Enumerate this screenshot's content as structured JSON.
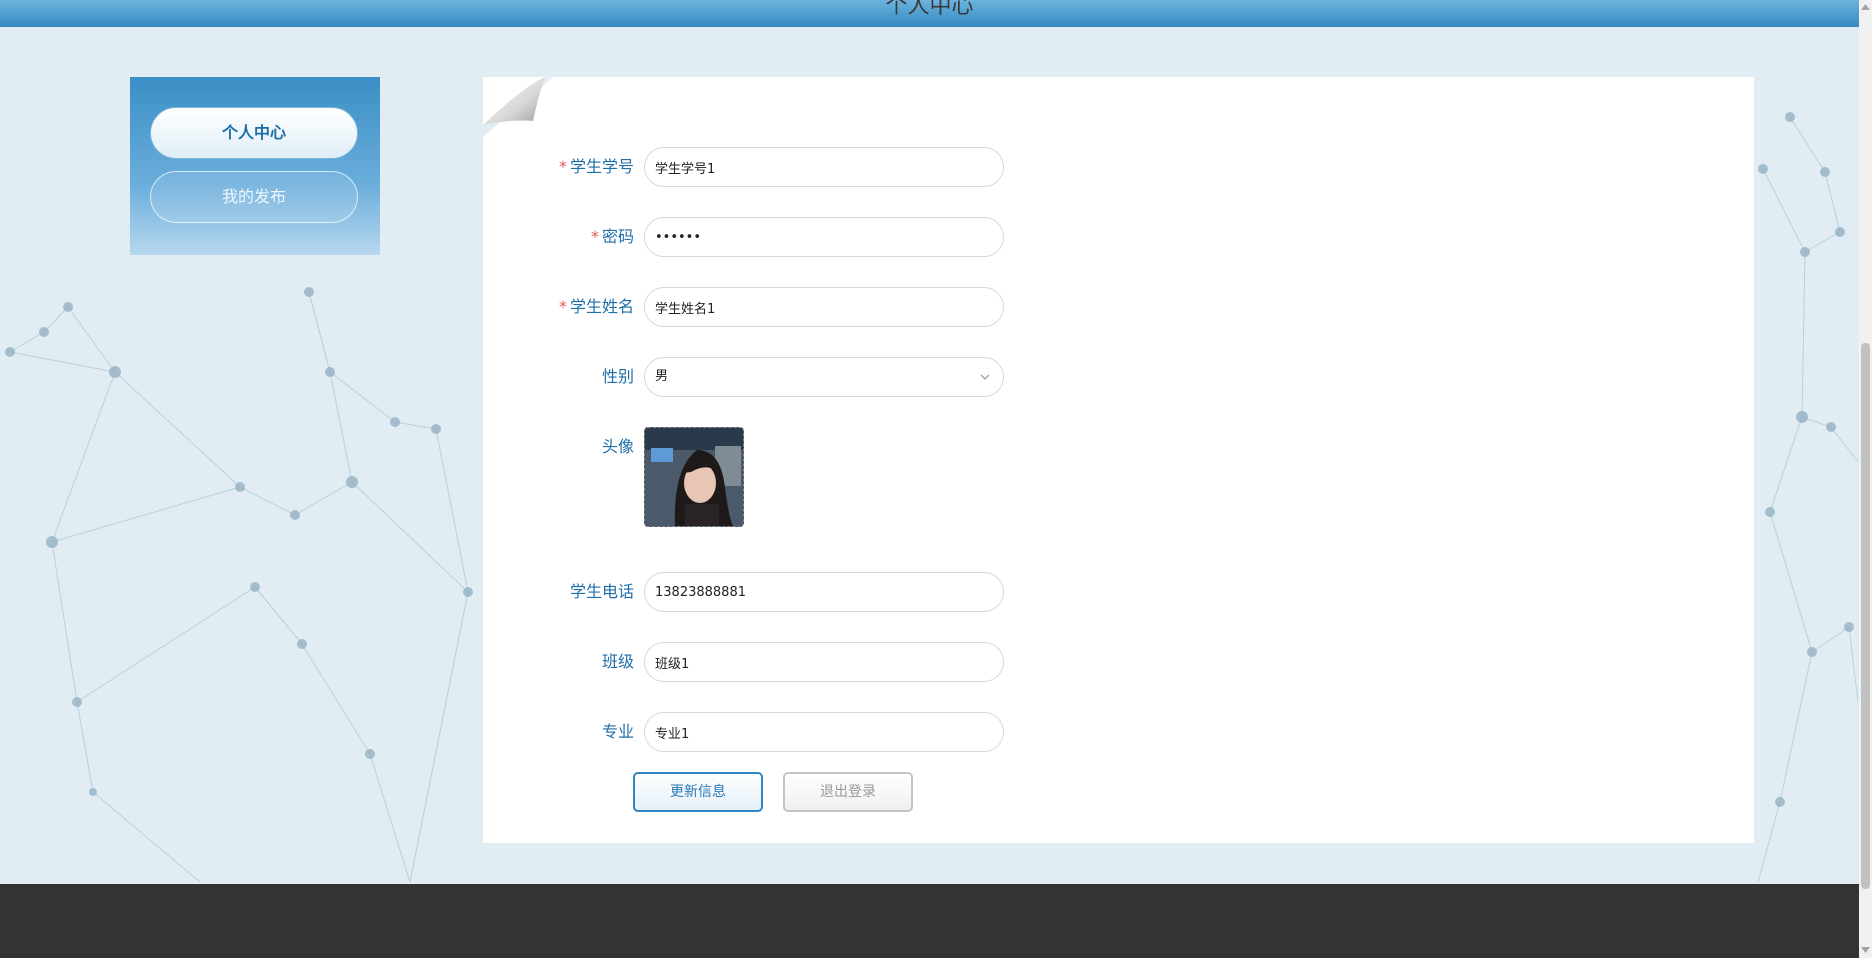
{
  "header": {
    "title": "个人中心"
  },
  "sidebar": {
    "items": [
      {
        "label": "个人中心",
        "active": true
      },
      {
        "label": "我的发布",
        "active": false
      }
    ]
  },
  "form": {
    "student_id": {
      "label": "学生学号",
      "required": true,
      "value": "学生学号1"
    },
    "password": {
      "label": "密码",
      "required": true,
      "value": "123456"
    },
    "student_name": {
      "label": "学生姓名",
      "required": true,
      "value": "学生姓名1"
    },
    "gender": {
      "label": "性别",
      "value": "男"
    },
    "avatar": {
      "label": "头像"
    },
    "phone": {
      "label": "学生电话",
      "value": "13823888881"
    },
    "class_name": {
      "label": "班级",
      "value": "班级1"
    },
    "major": {
      "label": "专业",
      "value": "专业1"
    }
  },
  "buttons": {
    "update": "更新信息",
    "logout": "退出登录"
  },
  "colors": {
    "accent": "#1e6ea8",
    "header": "#3389c3",
    "footer": "#333333",
    "required": "#e25b5b"
  },
  "icons": {
    "select": "chevron-down-icon",
    "page_corner": "page-curl-icon"
  }
}
